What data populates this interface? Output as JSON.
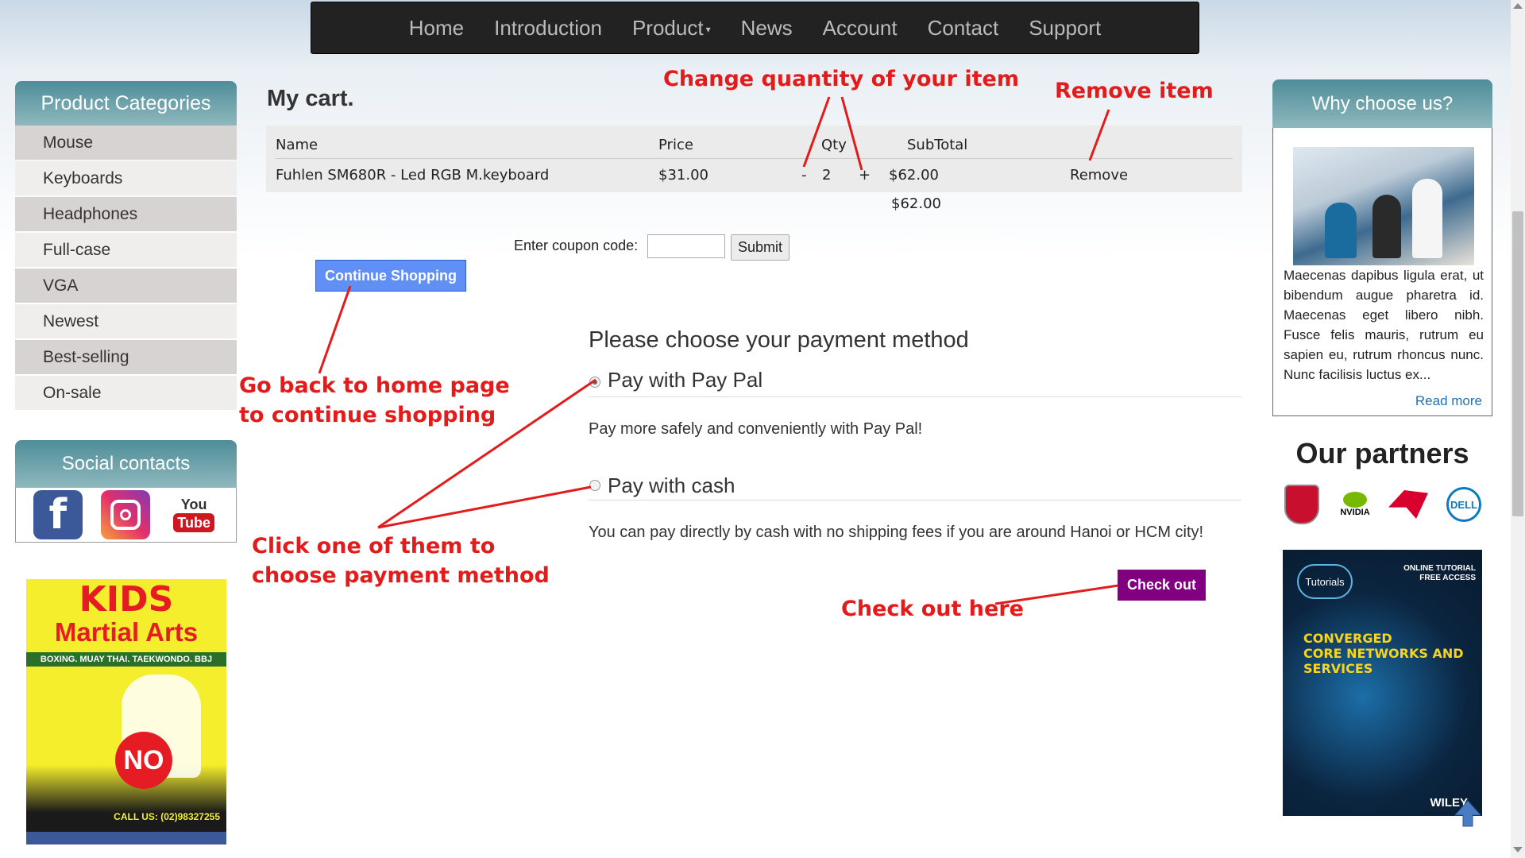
{
  "nav": {
    "items": [
      "Home",
      "Introduction",
      "Product",
      "News",
      "Account",
      "Contact",
      "Support"
    ]
  },
  "sidebar": {
    "categories_title": "Product Categories",
    "categories": [
      "Mouse",
      "Keyboards",
      "Headphones",
      "Full-case",
      "VGA",
      "Newest",
      "Best-selling",
      "On-sale"
    ],
    "social_title": "Social contacts",
    "social_icons": [
      "facebook-icon",
      "instagram-icon",
      "youtube-icon"
    ],
    "youtube_text": {
      "you": "You",
      "tube": "Tube"
    },
    "kids_ad": {
      "line1": "KIDS",
      "line2": "Martial Arts",
      "line3": "BOXING. MUAY THAI. TAEKWONDO. BBJ",
      "no": "NO",
      "call": "CALL US: (02)98327255"
    }
  },
  "cart": {
    "title": "My cart.",
    "headers": {
      "name": "Name",
      "price": "Price",
      "qty": "Qty",
      "subtotal": "SubTotal"
    },
    "items": [
      {
        "name": "Fuhlen SM680R - Led RGB M.keyboard",
        "price": "$31.00",
        "minus": "-",
        "qty": "2",
        "plus": "+",
        "subtotal": "$62.00",
        "remove": "Remove"
      }
    ],
    "total": "$62.00"
  },
  "coupon": {
    "label": "Enter coupon code:",
    "value": "",
    "submit": "Submit"
  },
  "continue_label": "Continue Shopping",
  "payment": {
    "title": "Please choose your payment method",
    "options": [
      {
        "label": "Pay with Pay Pal",
        "desc": "Pay more safely and conveniently with Pay Pal!",
        "checked": true
      },
      {
        "label": "Pay with cash",
        "desc": "You can pay directly by cash with no shipping fees if you are around Hanoi or HCM city!",
        "checked": false
      }
    ]
  },
  "checkout_label": "Check out",
  "annotations": {
    "quantity": "Change quantity of your item",
    "remove": "Remove item",
    "home_1": "Go back to home page",
    "home_2": "to continue shopping",
    "pay_1": "Click one of them to",
    "pay_2": "choose payment method",
    "checkout": "Check out here",
    "color": "#e31b1b"
  },
  "why": {
    "title": "Why choose us?",
    "text": "Maecenas dapibus ligula erat, ut bibendum augue pharetra id. Maecenas eget libero nibh. Fusce felis mauris, rutrum eu sapien eu, rutrum rhoncus nunc. Nunc facilisis luctus ex...",
    "read_more": "Read more"
  },
  "partners": {
    "title": "Our partners",
    "logos": [
      "msi-logo",
      "nvidia-logo",
      "rog-logo",
      "dell-logo"
    ],
    "nvidia_text": "NVIDIA",
    "dell_text": "DELL"
  },
  "tutorial_ad": {
    "head": "ONLINE TUTORIAL",
    "head2": "FREE ACCESS",
    "logo": "Tutorials",
    "conv1": "CONVERGED",
    "conv2": "CORE NETWORKS AND",
    "conv3": "SERVICES",
    "wiley": "WILEY"
  },
  "colors": {
    "nav_bg": "#222222",
    "panel_head": "#4e8d98",
    "continue_btn": "#5f8ff7",
    "checkout_btn": "#800080",
    "link": "#1e6fb5"
  }
}
